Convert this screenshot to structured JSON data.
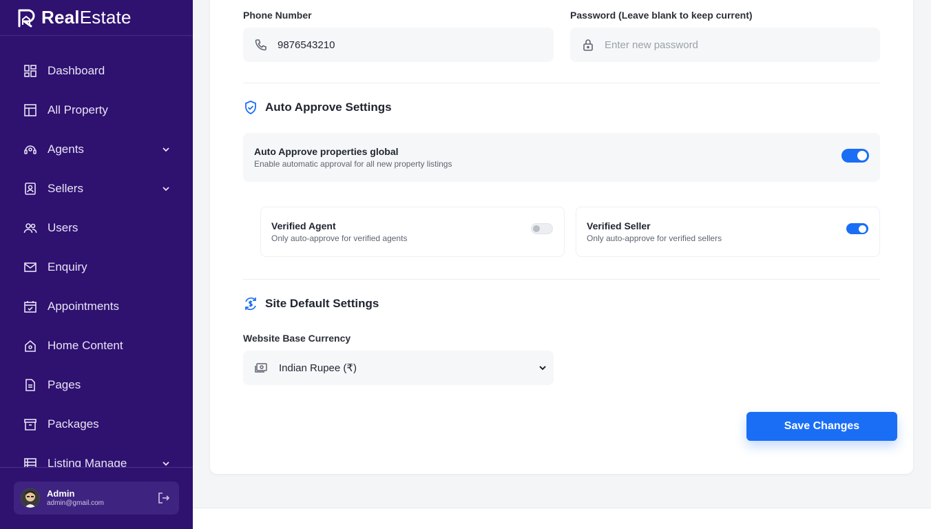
{
  "brand": {
    "name_bold": "Real",
    "name_regular": "Estate"
  },
  "sidebar": {
    "items": [
      {
        "label": "Dashboard",
        "icon": "dashboard-icon",
        "has_chevron": false
      },
      {
        "label": "All Property",
        "icon": "building-icon",
        "has_chevron": false
      },
      {
        "label": "Agents",
        "icon": "headset-icon",
        "has_chevron": true
      },
      {
        "label": "Sellers",
        "icon": "id-badge-icon",
        "has_chevron": true
      },
      {
        "label": "Users",
        "icon": "users-icon",
        "has_chevron": false
      },
      {
        "label": "Enquiry",
        "icon": "mail-icon",
        "has_chevron": false
      },
      {
        "label": "Appointments",
        "icon": "calendar-check-icon",
        "has_chevron": false
      },
      {
        "label": "Home Content",
        "icon": "home-icon",
        "has_chevron": false
      },
      {
        "label": "Pages",
        "icon": "document-icon",
        "has_chevron": false
      },
      {
        "label": "Packages",
        "icon": "archive-icon",
        "has_chevron": false
      },
      {
        "label": "Listing Manage",
        "icon": "list-icon",
        "has_chevron": true
      }
    ],
    "user": {
      "name": "Admin",
      "email": "admin@gmail.com"
    }
  },
  "form": {
    "phone": {
      "label": "Phone Number",
      "value": "9876543210"
    },
    "password": {
      "label": "Password (Leave blank to keep current)",
      "placeholder": "Enter new password"
    }
  },
  "auto_approve": {
    "title": "Auto Approve Settings",
    "global": {
      "title": "Auto Approve properties global",
      "desc": "Enable automatic approval for all new property listings",
      "enabled": true
    },
    "verified_agent": {
      "title": "Verified Agent",
      "desc": "Only auto-approve for verified agents",
      "enabled": false
    },
    "verified_seller": {
      "title": "Verified Seller",
      "desc": "Only auto-approve for verified sellers",
      "enabled": true
    }
  },
  "site_defaults": {
    "title": "Site Default Settings",
    "currency_label": "Website Base Currency",
    "currency_value": "Indian Rupee (₹)"
  },
  "actions": {
    "save_label": "Save Changes"
  },
  "colors": {
    "sidebar_bg": "#2f1170",
    "accent": "#1a6ef5"
  }
}
